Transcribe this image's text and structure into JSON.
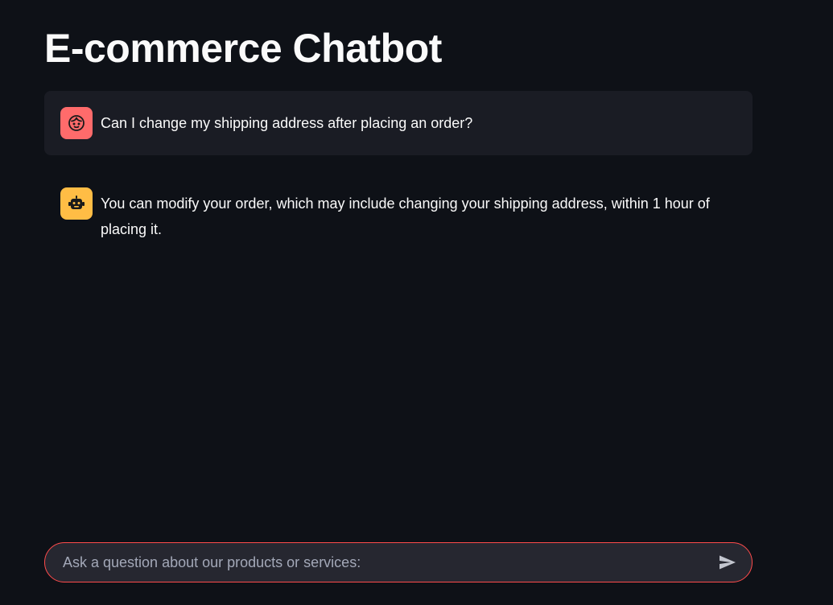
{
  "page": {
    "title": "E-commerce Chatbot"
  },
  "messages": [
    {
      "role": "user",
      "avatar_icon": "user-face-icon",
      "text": "Can I change my shipping address after placing an order?"
    },
    {
      "role": "assistant",
      "avatar_icon": "robot-icon",
      "text": "You can modify your order, which may include changing your shipping address, within 1 hour of placing it."
    }
  ],
  "chat_input": {
    "placeholder": "Ask a question about our products or services:",
    "value": "",
    "send_icon": "send-icon"
  },
  "colors": {
    "background": "#0e1117",
    "user_avatar": "#ff6b6b",
    "assistant_avatar": "#ffbd45",
    "accent_border": "#ff4b4b"
  }
}
